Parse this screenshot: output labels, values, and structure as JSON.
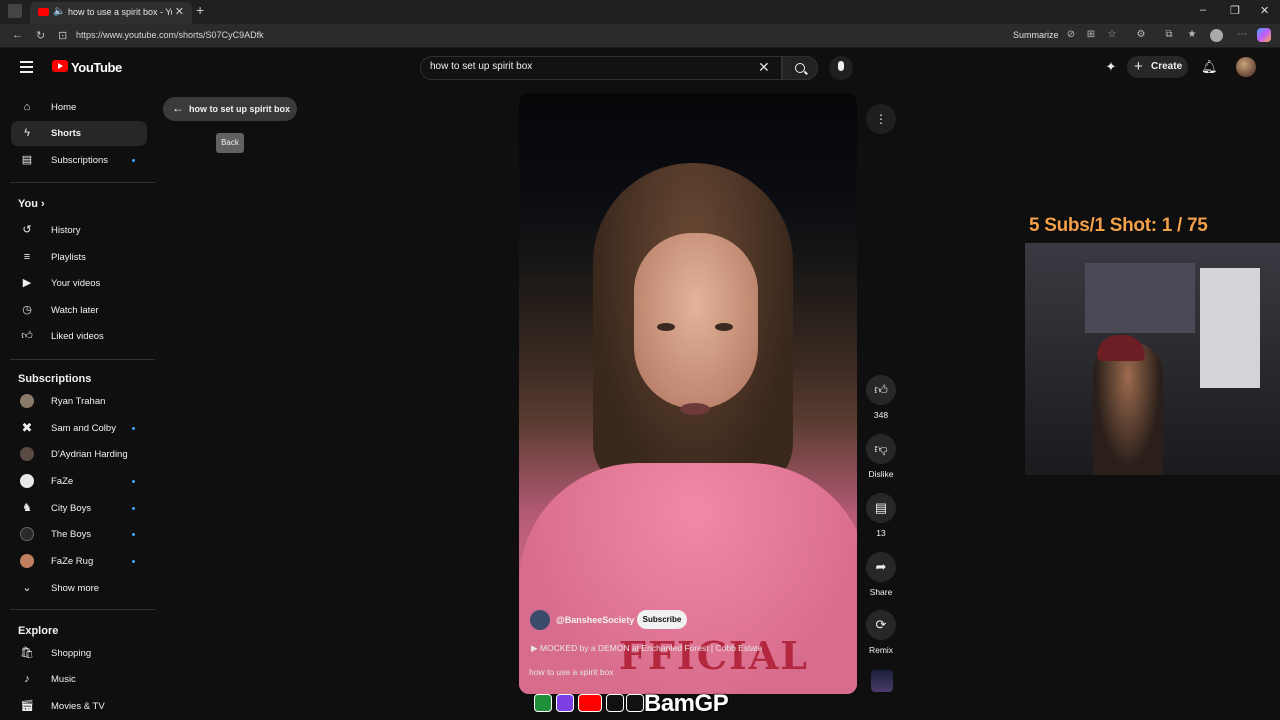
{
  "browser": {
    "tab_title": "how to use a spirit box - Yo...",
    "url": "https://www.youtube.com/shorts/S07CyC9ADfk",
    "summarize_label": "Summarize"
  },
  "header": {
    "logo_text": "YouTube",
    "search_value": "how to set up spirit box",
    "create_label": "Create"
  },
  "sidebar": {
    "main": [
      {
        "label": "Home",
        "icon": "home-icon"
      },
      {
        "label": "Shorts",
        "icon": "shorts-icon"
      },
      {
        "label": "Subscriptions",
        "icon": "subscriptions-icon"
      }
    ],
    "you_heading": "You",
    "you": [
      {
        "label": "History",
        "icon": "history-icon"
      },
      {
        "label": "Playlists",
        "icon": "playlists-icon"
      },
      {
        "label": "Your videos",
        "icon": "your-videos-icon"
      },
      {
        "label": "Watch later",
        "icon": "watch-later-icon"
      },
      {
        "label": "Liked videos",
        "icon": "liked-videos-icon"
      }
    ],
    "subscriptions_heading": "Subscriptions",
    "subscriptions": [
      {
        "label": "Ryan Trahan"
      },
      {
        "label": "Sam and Colby"
      },
      {
        "label": "D'Aydrian Harding"
      },
      {
        "label": "FaZe"
      },
      {
        "label": "City Boys"
      },
      {
        "label": "The Boys"
      },
      {
        "label": "FaZe Rug"
      }
    ],
    "show_more_label": "Show more",
    "explore_heading": "Explore",
    "explore": [
      {
        "label": "Shopping",
        "icon": "shopping-icon"
      },
      {
        "label": "Music",
        "icon": "music-icon"
      },
      {
        "label": "Movies & TV",
        "icon": "movies-icon"
      }
    ]
  },
  "back_chip": {
    "label": "how to set up spirit box",
    "tooltip": "Back"
  },
  "short": {
    "channel": "@BansheeSociety",
    "subscribe_label": "Subscribe",
    "linked_video": "MOCKED by a DEMON at Enchanted Forest | Cobb Estate",
    "title": "how to use a spirit box",
    "sweater_print": "FFICIAL"
  },
  "actions": {
    "like_count": "348",
    "dislike_label": "Dislike",
    "comment_count": "13",
    "share_label": "Share",
    "remix_label": "Remix"
  },
  "stream_overlay": {
    "counter_text": "5 Subs/1 Shot:  1 / 75",
    "brand": "BamGP"
  },
  "colors": {
    "accent_red": "#ff0000",
    "dot_blue": "#3ea6ff",
    "overlay_orange": "#f2a14a"
  }
}
